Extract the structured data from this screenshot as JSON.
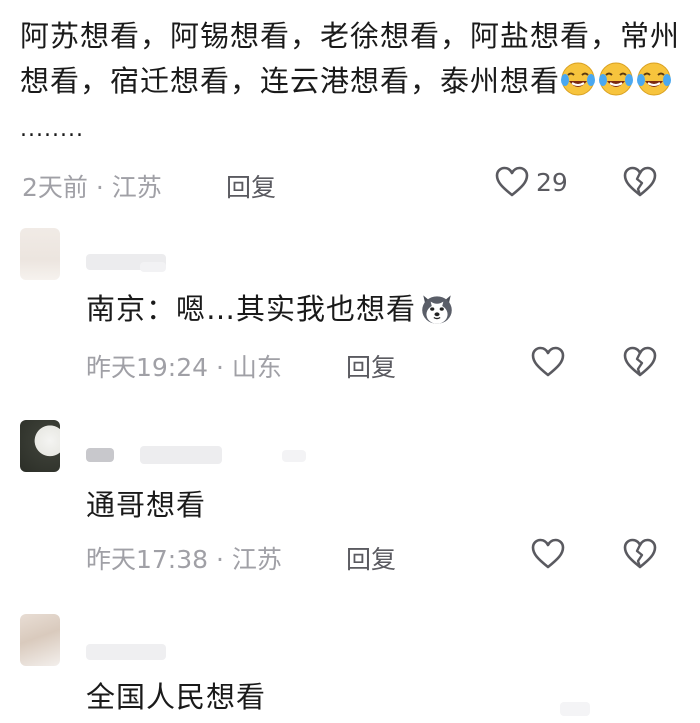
{
  "top_comment": {
    "text": "阿苏想看，阿锡想看，老徐想看，阿盐想看，常州想看，宿迁想看，连云港想看，泰州想看",
    "trailing": "........",
    "emoji_icon": "laugh-cry-emoji",
    "meta": "2天前 · 江苏",
    "reply_label": "回复",
    "like_count": "29"
  },
  "replies": [
    {
      "text": "南京：嗯…其实我也想看",
      "emoji_icon": "husky-dog-emoji",
      "meta": "昨天19:24 · 山东",
      "reply_label": "回复"
    },
    {
      "text": "通哥想看",
      "meta": "昨天17:38 · 江苏",
      "reply_label": "回复"
    },
    {
      "text": "全国人民想看"
    }
  ],
  "colors": {
    "meta_gray": "#a0a0a6",
    "reply_gray": "#5a5a60",
    "emoji_yellow": "#f7c43d",
    "tear_blue": "#4aa8f0"
  }
}
